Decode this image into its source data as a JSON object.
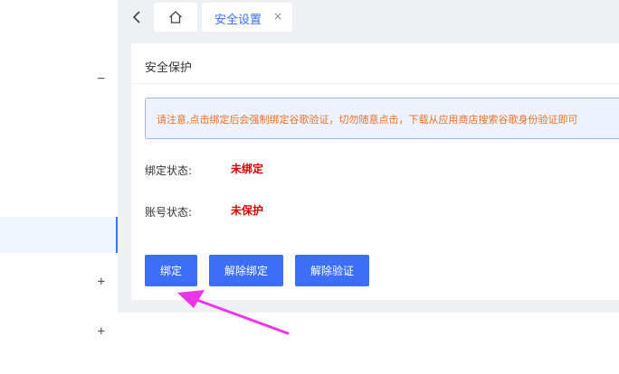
{
  "sidebar": {
    "items": [
      {
        "sign": "−"
      },
      {
        "label": "▸"
      },
      {
        "label": "⁖"
      },
      {
        "label": "⁖",
        "active": true
      },
      {
        "sign": "+"
      },
      {
        "sign": "+"
      }
    ]
  },
  "tabs": {
    "active_label": "安全设置",
    "close": "×"
  },
  "card": {
    "title": "安全保护",
    "notice": "请注意,点击绑定后会强制绑定谷歌验证，切勿随意点击，下载从应用商店搜索谷歌身份验证即可",
    "bind_status_label": "绑定状态:",
    "bind_status_value": "未绑定",
    "account_status_label": "账号状态:",
    "account_status_value": "未保护"
  },
  "buttons": {
    "bind": "绑定",
    "unbind": "解除绑定",
    "remove_verify": "解除验证"
  },
  "colors": {
    "primary": "#3d6ef7",
    "danger": "#d40000",
    "warning_text": "#e6732c",
    "annotation_arrow": "#ee34e8"
  }
}
